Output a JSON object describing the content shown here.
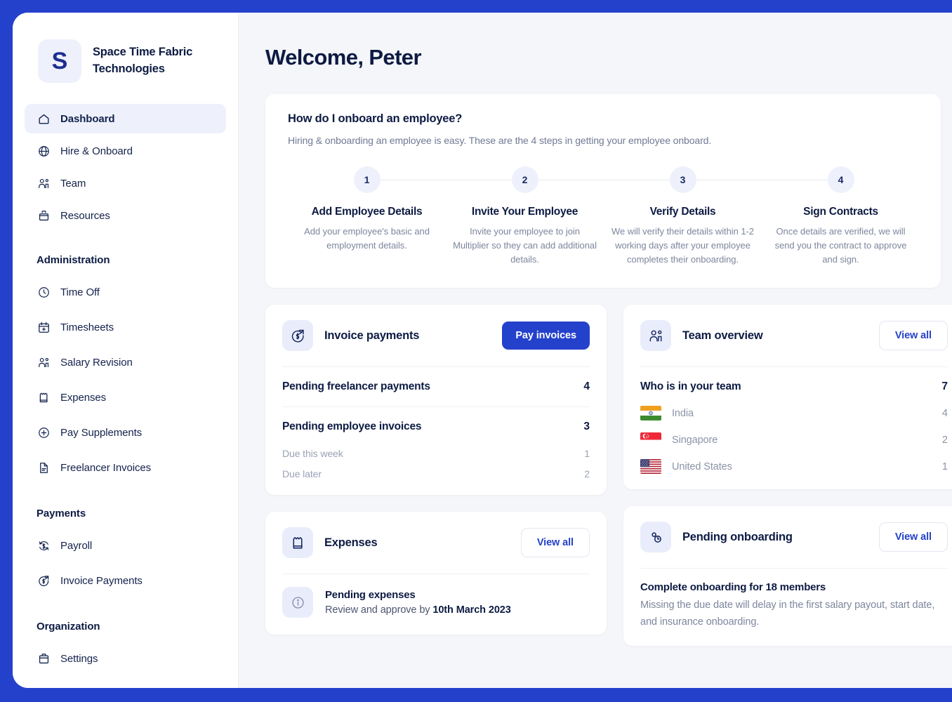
{
  "theme": {
    "frame_blue": "#2441cc",
    "navy": "#0d1b43",
    "muted": "#7d869c",
    "icon_bg": "#e9edfb",
    "page_bg": "#f4f6f9"
  },
  "sidebar": {
    "brand": {
      "initial": "S",
      "name": "Space Time Fabric Technologies"
    },
    "main_items": [
      {
        "label": "Dashboard",
        "icon": "home-icon",
        "active": true
      },
      {
        "label": "Hire & Onboard",
        "icon": "globe-icon",
        "active": false
      },
      {
        "label": "Team",
        "icon": "people-icon",
        "active": false
      },
      {
        "label": "Resources",
        "icon": "briefcase-icon",
        "active": false
      }
    ],
    "sections": [
      {
        "title": "Administration",
        "items": [
          {
            "label": "Time Off",
            "icon": "clock-icon"
          },
          {
            "label": "Timesheets",
            "icon": "calendar-plus-icon"
          },
          {
            "label": "Salary Revision",
            "icon": "people-icon"
          },
          {
            "label": "Expenses",
            "icon": "receipt-icon"
          },
          {
            "label": "Pay Supplements",
            "icon": "plus-circle-icon"
          },
          {
            "label": "Freelancer Invoices",
            "icon": "document-icon"
          }
        ]
      },
      {
        "title": "Payments",
        "items": [
          {
            "label": "Payroll",
            "icon": "dollar-refresh-icon"
          },
          {
            "label": "Invoice Payments",
            "icon": "dollar-arrow-icon"
          }
        ]
      },
      {
        "title": "Organization",
        "items": [
          {
            "label": "Settings",
            "icon": "briefcase-icon"
          }
        ]
      }
    ]
  },
  "main": {
    "page_title": "Welcome, Peter",
    "onboarding": {
      "question": "How do I onboard an employee?",
      "subtitle": "Hiring & onboarding an employee is easy. These are the 4 steps in getting your employee onboard.",
      "steps": [
        {
          "number": "1",
          "title": "Add Employee Details",
          "desc": "Add your employee's basic and employment details."
        },
        {
          "number": "2",
          "title": "Invite Your Employee",
          "desc": "Invite your employee to join Multiplier so they can add additional details."
        },
        {
          "number": "3",
          "title": "Verify Details",
          "desc": "We will verify their details within 1-2 working days after your employee completes their onboarding."
        },
        {
          "number": "4",
          "title": "Sign Contracts",
          "desc": "Once details are verified, we will send you the contract to approve and sign."
        }
      ]
    },
    "invoice_payments": {
      "icon": "dollar-arrow-icon",
      "title": "Invoice payments",
      "action_label": "Pay invoices",
      "freelancer": {
        "label": "Pending freelancer payments",
        "count": "4"
      },
      "employee": {
        "label": "Pending employee invoices",
        "count": "3"
      },
      "employee_breakdown": [
        {
          "label": "Due this week",
          "count": "1"
        },
        {
          "label": "Due later",
          "count": "2"
        }
      ]
    },
    "team_overview": {
      "icon": "people-icon",
      "title": "Team overview",
      "action_label": "View all",
      "summary": {
        "label": "Who is in your team",
        "count": "7"
      },
      "countries": [
        {
          "name": "India",
          "count": "4",
          "flag": "flag-india"
        },
        {
          "name": "Singapore",
          "count": "2",
          "flag": "flag-singapore"
        },
        {
          "name": "United States",
          "count": "1",
          "flag": "flag-united-states"
        }
      ]
    },
    "expenses": {
      "icon": "receipt-icon",
      "title": "Expenses",
      "action_label": "View all",
      "pending_title": "Pending expenses",
      "pending_prefix": "Review and approve by ",
      "pending_date": "10th March 2023"
    },
    "pending_onboarding": {
      "icon": "pending-clock-icon",
      "title": "Pending onboarding",
      "action_label": "View all",
      "block_title": "Complete onboarding for 18 members",
      "block_text": "Missing the due date will delay in the first salary payout, start date, and insurance onboarding."
    }
  }
}
